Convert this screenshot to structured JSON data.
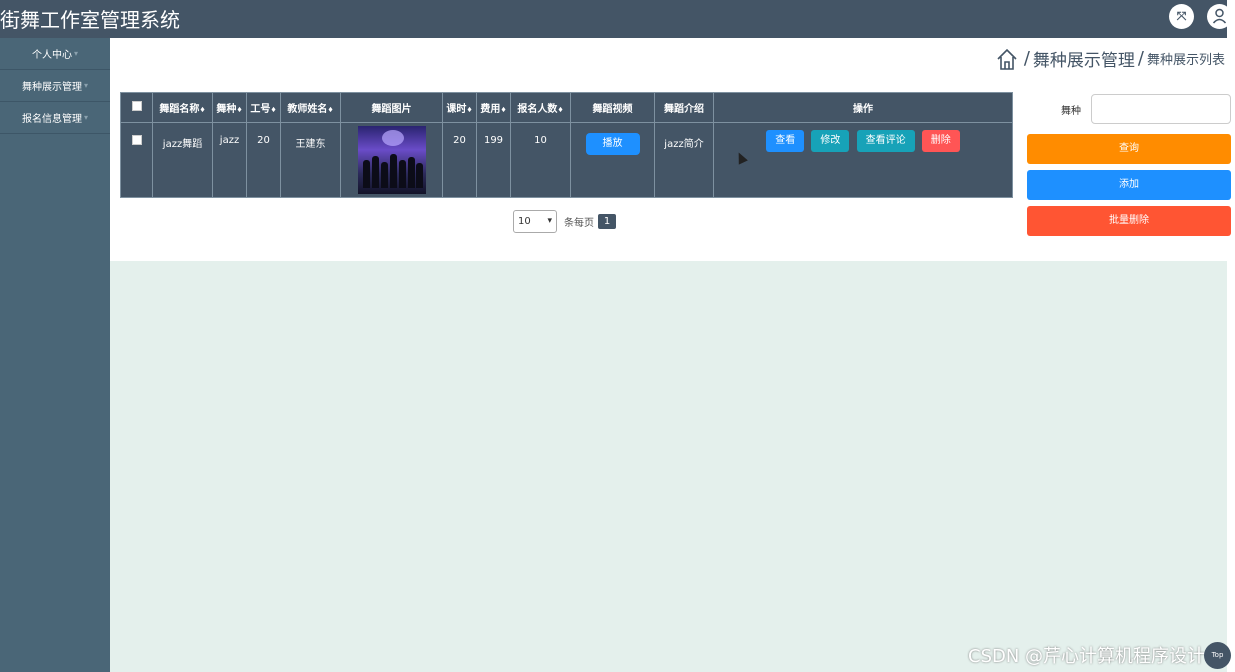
{
  "app": {
    "title": "街舞工作室管理系统"
  },
  "topbar": {
    "fullscreen_icon": "fullscreen-icon",
    "user_icon": "user-icon"
  },
  "sidebar": {
    "items": [
      {
        "label": "个人中心"
      },
      {
        "label": "舞种展示管理"
      },
      {
        "label": "报名信息管理"
      }
    ]
  },
  "breadcrumb": {
    "home_icon": "home-icon",
    "sep": "/",
    "section": "舞种展示管理",
    "page": "舞种展示列表"
  },
  "table": {
    "sort_glyph": "♦",
    "headers": [
      "舞蹈名称",
      "舞种",
      "工号",
      "教师姓名",
      "舞蹈图片",
      "课时",
      "费用",
      "报名人数",
      "舞蹈视频",
      "舞蹈介绍",
      "操作"
    ],
    "rows": [
      {
        "name": "jazz舞蹈",
        "type": "jazz",
        "id": "20",
        "teacher": "王建东",
        "hours": "20",
        "fee": "199",
        "enrolled": "10",
        "video_button": "播放",
        "intro": "jazz简介"
      }
    ],
    "actions": {
      "view": "查看",
      "edit": "修改",
      "comments": "查看评论",
      "delete": "删除"
    }
  },
  "pagination": {
    "page_size": "10",
    "per_page_label": "条每页",
    "current_page": "1"
  },
  "search": {
    "label": "舞种",
    "value": ""
  },
  "buttons": {
    "query": "查询",
    "add": "添加",
    "batch_delete": "批量删除"
  },
  "watermark": "CSDN @芹心计算机程序设计",
  "back_to_top": "Top",
  "colors": {
    "header": "#445566",
    "sidebar": "#4a6677",
    "query": "#ff8c00",
    "add": "#1e90ff",
    "batch_delete": "#ff5533",
    "delete": "#ff5555",
    "edit": "#17a2b8",
    "content_bg": "#e4f0ec"
  }
}
